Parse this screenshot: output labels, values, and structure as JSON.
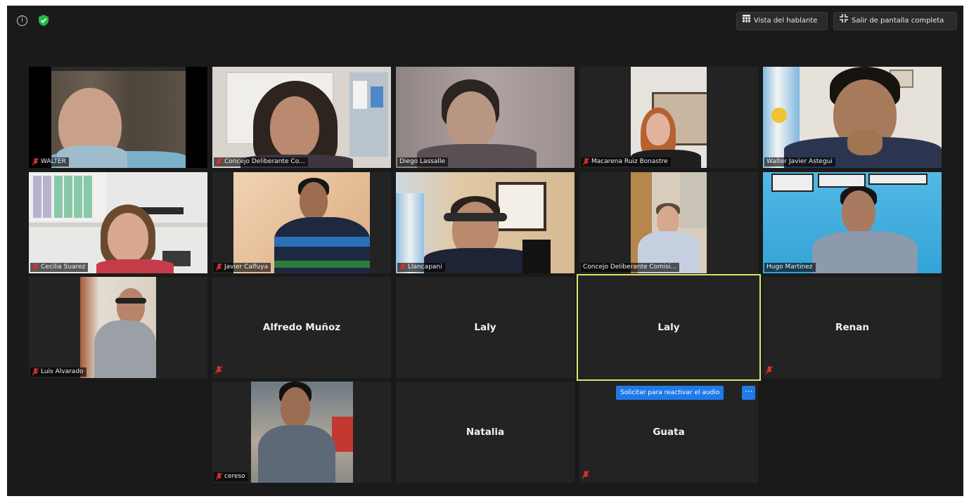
{
  "toolbar": {
    "info_icon": "info-icon",
    "security_icon": "shield-icon",
    "gallery_view_label": "Vista del hablante",
    "fullscreen_label": "Salir de pantalla completa"
  },
  "participants": [
    {
      "name": "WALTER",
      "muted": true,
      "video": true
    },
    {
      "name": "Concejo Deliberante Co...",
      "muted": true,
      "video": true
    },
    {
      "name": "Diego Lassalle",
      "muted": false,
      "video": true
    },
    {
      "name": "Macarena Ruiz Bonastre",
      "muted": true,
      "video": true
    },
    {
      "name": "Walter Javier Astegui",
      "muted": false,
      "video": true
    },
    {
      "name": "Cecilia Suarez",
      "muted": true,
      "video": true
    },
    {
      "name": "Javier Calfuya",
      "muted": true,
      "video": true
    },
    {
      "name": "Llancapani",
      "muted": true,
      "video": true
    },
    {
      "name": "Concejo Deliberante Comisi...",
      "muted": false,
      "video": true
    },
    {
      "name": "Hugo Martinez",
      "muted": false,
      "video": true
    },
    {
      "name": "Luis Alvarado",
      "muted": true,
      "video": true
    },
    {
      "name": "Alfredo Muñoz",
      "muted": true,
      "video": false
    },
    {
      "name": "Laly",
      "muted": false,
      "video": false
    },
    {
      "name": "Laly",
      "muted": false,
      "video": false,
      "active_speaker": true
    },
    {
      "name": "Renan",
      "muted": true,
      "video": false
    },
    {
      "name": "cereso",
      "muted": true,
      "video": true
    },
    {
      "name": "Natalia",
      "muted": false,
      "video": false
    },
    {
      "name": "Guata",
      "muted": true,
      "video": false
    }
  ],
  "audio_request": {
    "label": "Solicitar para reactivar el audio",
    "more_label": "···"
  },
  "colors": {
    "background": "#1a1a1a",
    "tile": "#232323",
    "active_speaker_border": "#d8e86a",
    "mute_icon": "#e0302a",
    "accent_button": "#1f7ae8"
  }
}
